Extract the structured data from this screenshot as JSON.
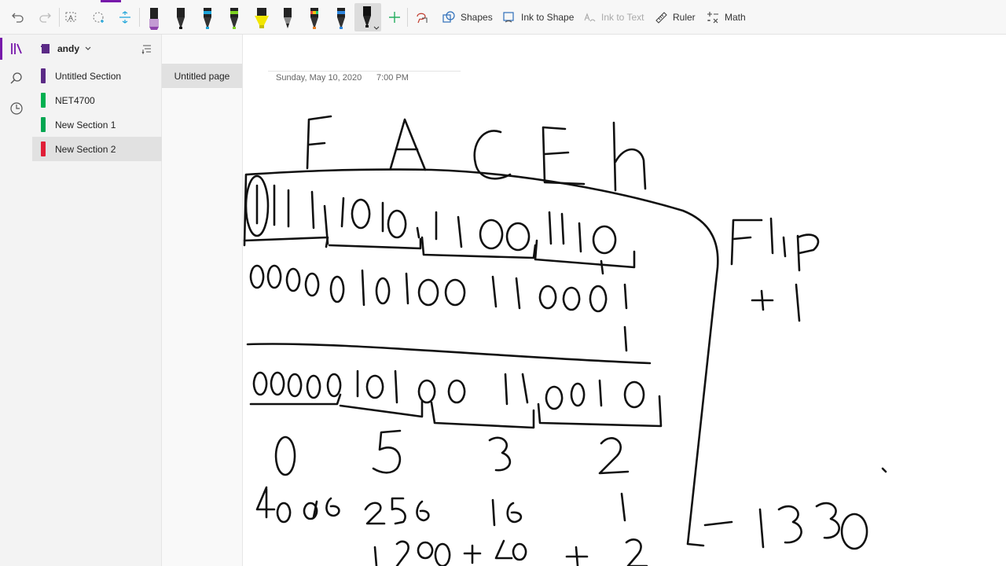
{
  "toolbar": {
    "undo_icon": "undo-icon",
    "redo_icon": "redo-icon",
    "lasso_text_icon": "lasso-select-icon",
    "eraser_icon": "eraser-icon",
    "add_space_icon": "add-space-icon",
    "pens": [
      {
        "name": "purple-highlighter",
        "color": "#8e44ad"
      },
      {
        "name": "black-pen-1",
        "color": "#111111"
      },
      {
        "name": "cyan-pen",
        "color": "#1aa3d9"
      },
      {
        "name": "green-pen",
        "color": "#7ed321"
      },
      {
        "name": "yellow-highlighter",
        "color": "#f2e600"
      },
      {
        "name": "pencil",
        "color": "#777777"
      },
      {
        "name": "rainbow-pen",
        "color": "#e67e22"
      },
      {
        "name": "blue-pen",
        "color": "#2e86de"
      },
      {
        "name": "black-pen-selected",
        "color": "#111111"
      }
    ],
    "add_pen_icon": "plus-icon",
    "ink_replay_icon": "lasso-icon",
    "shapes_label": "Shapes",
    "ink_to_shape_label": "Ink to Shape",
    "ink_to_text_label": "Ink to Text",
    "ruler_label": "Ruler",
    "math_label": "Math"
  },
  "notebook": {
    "name": "andy",
    "sort_icon": "sort-icon"
  },
  "sections": [
    {
      "label": "Untitled Section",
      "color": "#5b2a86"
    },
    {
      "label": "NET4700",
      "color": "#00b050"
    },
    {
      "label": "New Section 1",
      "color": "#00a651"
    },
    {
      "label": "New Section 2",
      "color": "#e01e37"
    }
  ],
  "pages": [
    {
      "label": "Untitled page"
    }
  ],
  "page": {
    "date": "Sunday, May 10, 2020",
    "time": "7:00 PM"
  },
  "colors": {
    "accent": "#7719aa",
    "ink": "#111111"
  }
}
